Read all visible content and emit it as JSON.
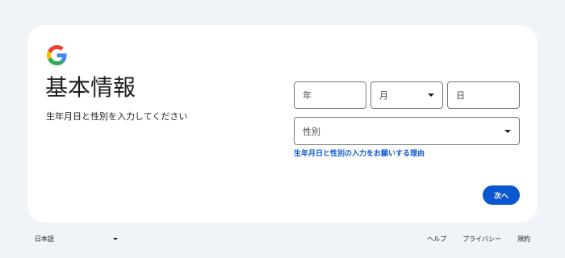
{
  "header": {
    "logo": "google-g-logo",
    "title": "基本情報",
    "subtitle": "生年月日と性別を入力してください"
  },
  "form": {
    "year_placeholder": "年",
    "month_label": "月",
    "day_placeholder": "日",
    "gender_label": "性別",
    "why_link": "生年月日と性別の入力をお願いする理由",
    "next_button": "次へ"
  },
  "footer": {
    "language": "日本語",
    "links": [
      "ヘルプ",
      "プライバシー",
      "規約"
    ]
  },
  "colors": {
    "page_background": "#f0f4f9",
    "card_background": "#ffffff",
    "accent": "#0b57d0",
    "field_border": "#747775",
    "google_blue": "#4285F4",
    "google_red": "#EA4335",
    "google_yellow": "#FBBC05",
    "google_green": "#34A853"
  }
}
